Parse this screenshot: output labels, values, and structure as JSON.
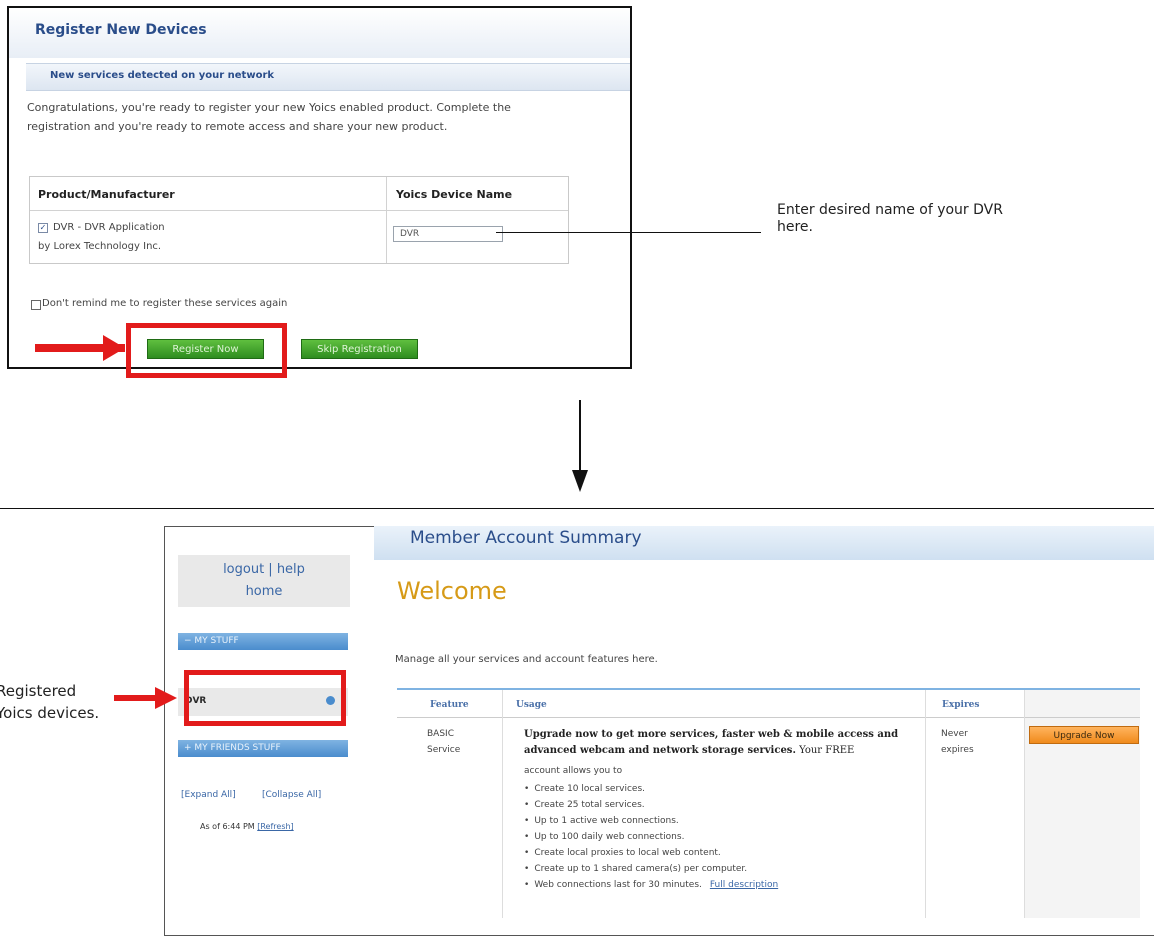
{
  "register_dialog": {
    "title": "Register New Devices",
    "detected_bar": "New services detected on your network",
    "congrats_text": "Congratulations, you're ready to register your new Yoics enabled product. Complete the registration and you're ready to remote access and share your new product.",
    "table": {
      "col_product": "Product/Manufacturer",
      "col_device_name": "Yoics Device Name",
      "product_line1": "DVR - DVR Application",
      "product_line2": "by Lorex Technology Inc.",
      "device_name_value": "DVR"
    },
    "dont_remind_label": "Don't remind me to register these services again",
    "register_button": "Register Now",
    "skip_button": "Skip Registration"
  },
  "callout_enter_name": "Enter desired name of your DVR here.",
  "account_summary": {
    "header_title": "Member Account Summary",
    "sidebar": {
      "logout_help": "logout | help",
      "home": "home",
      "my_stuff": "− MY STUFF",
      "dvr_item": "DVR",
      "friends_stuff": "+ MY FRIENDS STUFF",
      "expand_all": "[Expand All]",
      "collapse_all": "[Collapse All]",
      "as_of": "As of 6:44 PM",
      "refresh": "[Refresh]"
    },
    "welcome": "Welcome",
    "manage_text": "Manage all your services and account features here.",
    "table": {
      "col_feature": "Feature",
      "col_usage": "Usage",
      "col_expires": "Expires",
      "feature_line1": "BASIC",
      "feature_line2": "Service",
      "usage_bold": "Upgrade now to get more services, faster web & mobile access and advanced webcam and network storage services.",
      "usage_tail": " Your FREE",
      "usage_sub": "account allows you to",
      "usage_items": [
        "Create 10 local services.",
        "Create 25 total services.",
        "Up to 1 active web connections.",
        "Up to 100 daily web connections.",
        "Create local proxies to local web content.",
        "Create up to 1 shared camera(s) per computer.",
        "Web connections last for 30 minutes."
      ],
      "full_description": "Full description",
      "expires_line1": "Never",
      "expires_line2": "expires",
      "upgrade_button": "Upgrade Now"
    }
  },
  "callout_registered": [
    "Registered",
    "Yoics devices."
  ]
}
